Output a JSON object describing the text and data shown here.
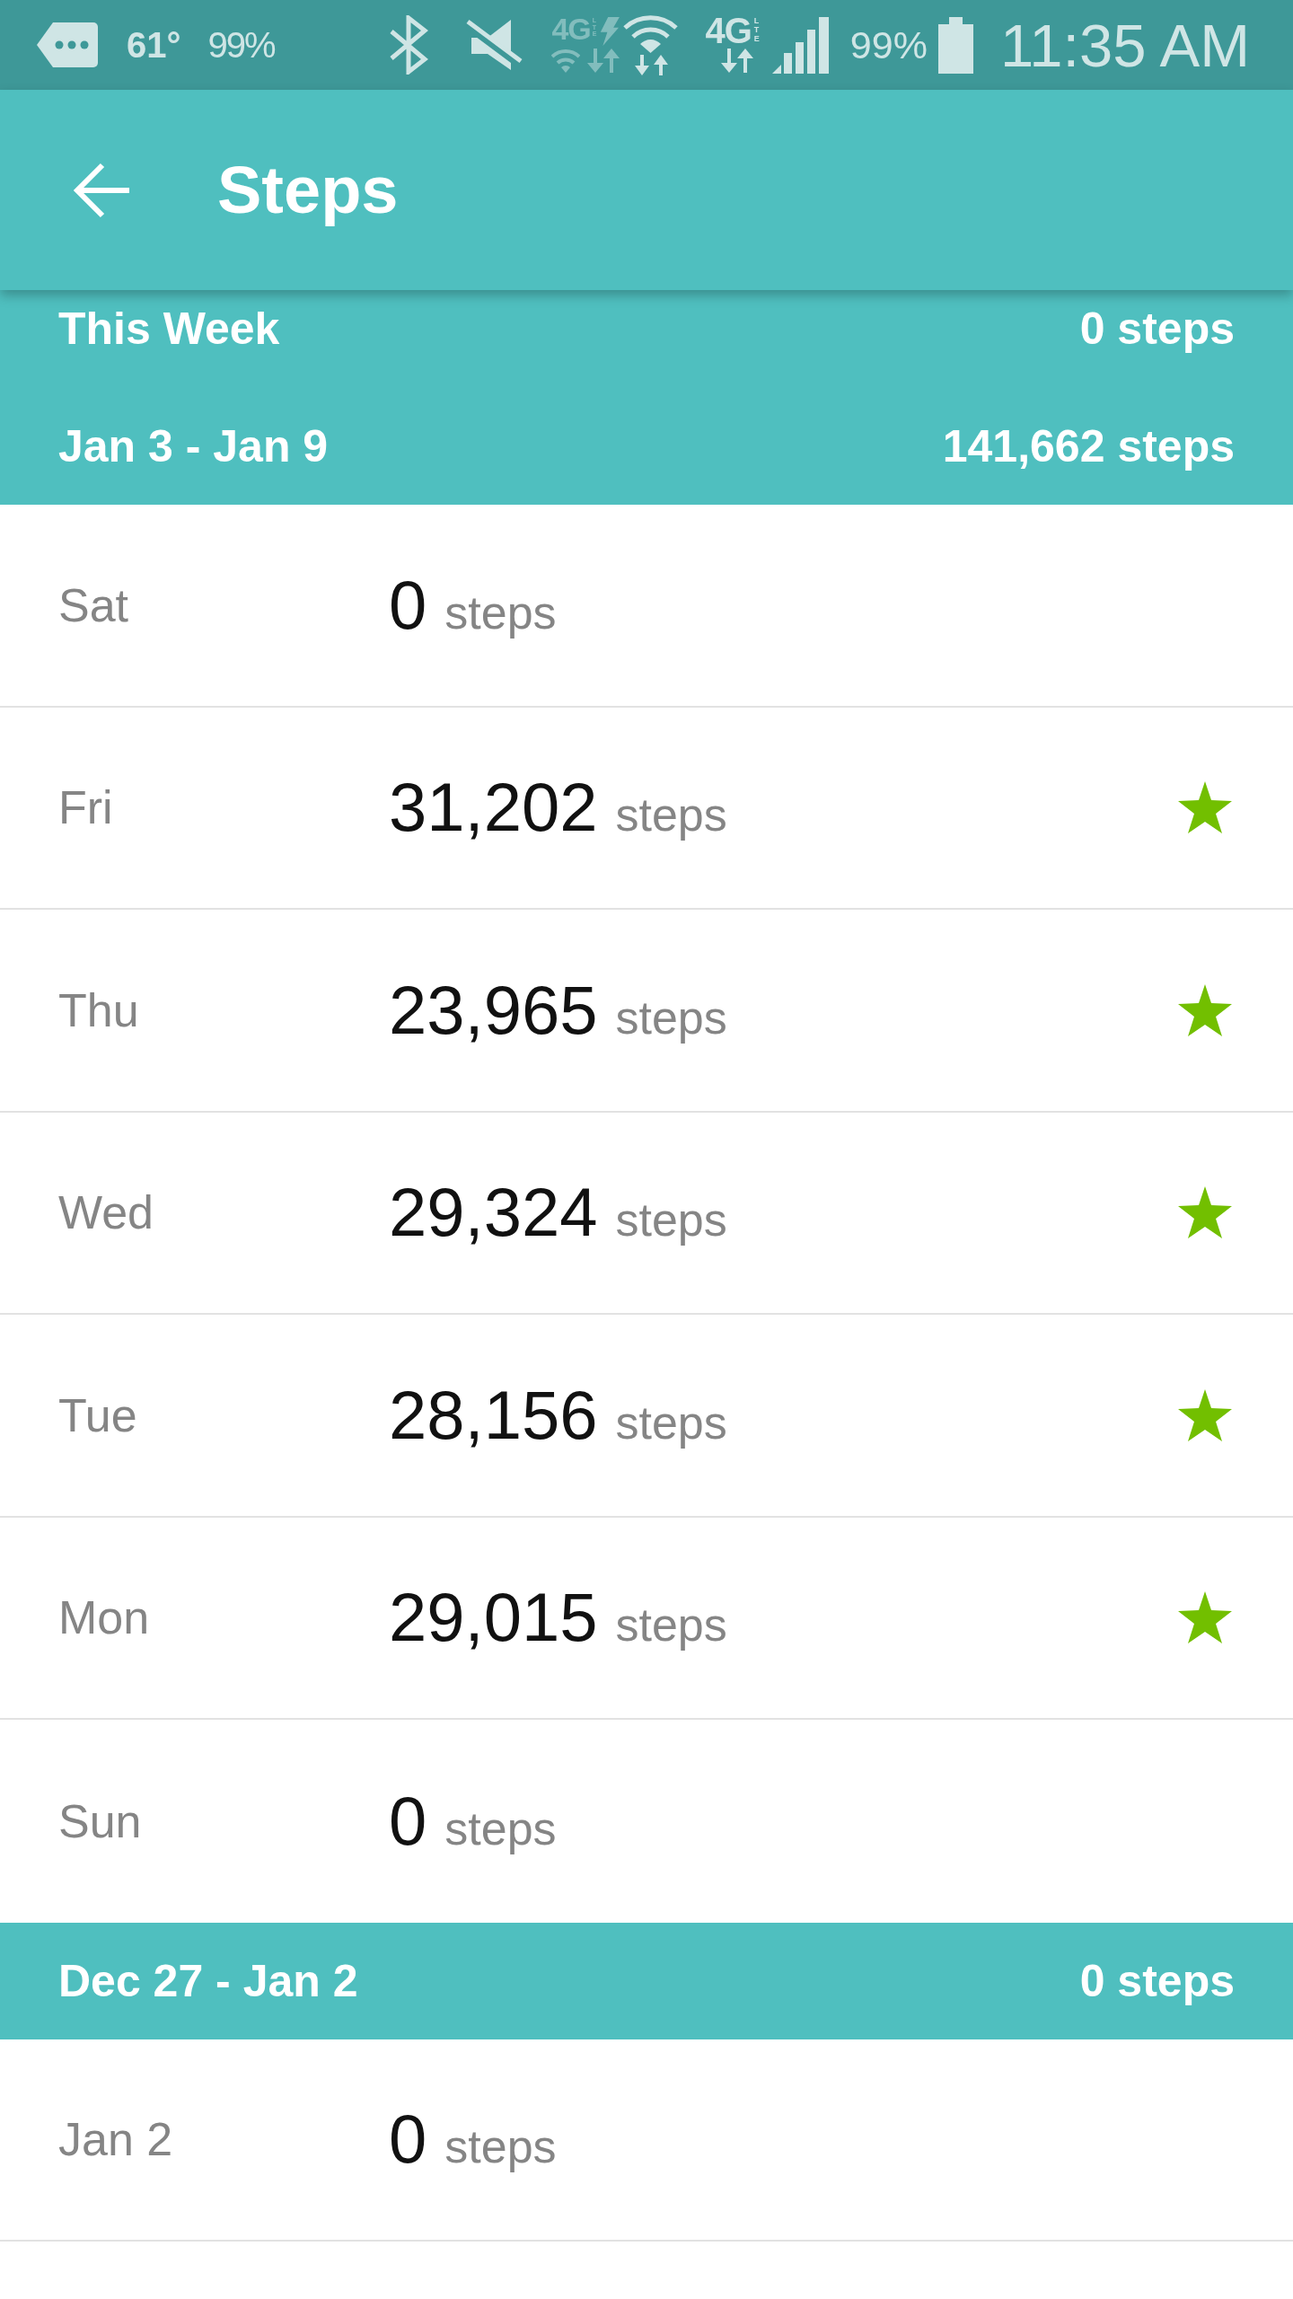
{
  "status_bar": {
    "temperature": "61°",
    "notification_percent": "99%",
    "indicators": [
      {
        "kind": "wifi_calling",
        "network": "4G",
        "sub": "LTE",
        "enabled": false
      },
      {
        "kind": "mobile_data",
        "network": "4G",
        "sub": "LTE",
        "enabled": true
      }
    ],
    "battery_percent": "99%",
    "time": "11:35 AM"
  },
  "app_bar": {
    "title": "Steps"
  },
  "summary": {
    "label": "This Week",
    "total": "0 steps"
  },
  "weeks": [
    {
      "range": "Jan 3 - Jan 9",
      "total": "141,662 steps",
      "days": [
        {
          "label": "Sat",
          "count": "0",
          "unit": "steps",
          "goal_met": false
        },
        {
          "label": "Fri",
          "count": "31,202",
          "unit": "steps",
          "goal_met": true
        },
        {
          "label": "Thu",
          "count": "23,965",
          "unit": "steps",
          "goal_met": true
        },
        {
          "label": "Wed",
          "count": "29,324",
          "unit": "steps",
          "goal_met": true
        },
        {
          "label": "Tue",
          "count": "28,156",
          "unit": "steps",
          "goal_met": true
        },
        {
          "label": "Mon",
          "count": "29,015",
          "unit": "steps",
          "goal_met": true
        },
        {
          "label": "Sun",
          "count": "0",
          "unit": "steps",
          "goal_met": false
        }
      ]
    },
    {
      "range": "Dec 27 - Jan 2",
      "total": "0 steps",
      "days": [
        {
          "label": "Jan 2",
          "count": "0",
          "unit": "steps",
          "goal_met": false
        }
      ]
    }
  ]
}
